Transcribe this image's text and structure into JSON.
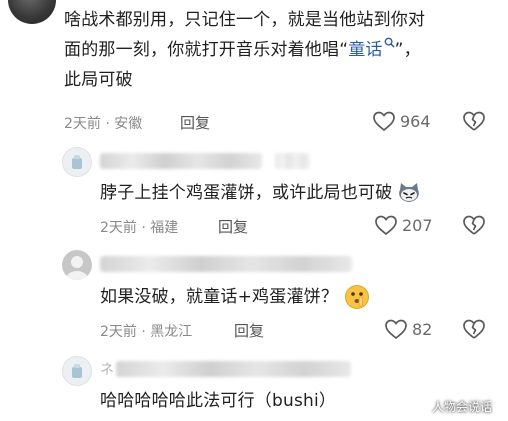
{
  "comments": [
    {
      "lines": [
        "啥战术都别用，只记住一个，就是当他站到你对",
        "面的那一刻，你就打开音乐对着他唱“",
        "童话",
        "”，",
        "此局可破"
      ],
      "meta": "2天前 · 安徽",
      "reply": "回复",
      "likes": "964"
    },
    {
      "text": "脖子上挂个鸡蛋灌饼，或许此局也可破",
      "meta": "2天前 · 福建",
      "reply": "回复",
      "likes": "207"
    },
    {
      "text": "如果没破，就童话+鸡蛋灌饼？",
      "meta": "2天前 · 黑龙江",
      "reply": "回复",
      "likes": "82"
    },
    {
      "name_prefix": "ネ",
      "text": "哈哈哈哈哈此法可行（bushi）"
    }
  ],
  "watermark": "人物会说话",
  "icons": [
    "heart-icon",
    "broken-heart-icon",
    "search-icon",
    "cat-emoji-icon",
    "shush-emoji-icon"
  ],
  "colors": {
    "link": "#2b5ba7",
    "meta": "#8a8a8a",
    "text": "#1f1f1f"
  }
}
